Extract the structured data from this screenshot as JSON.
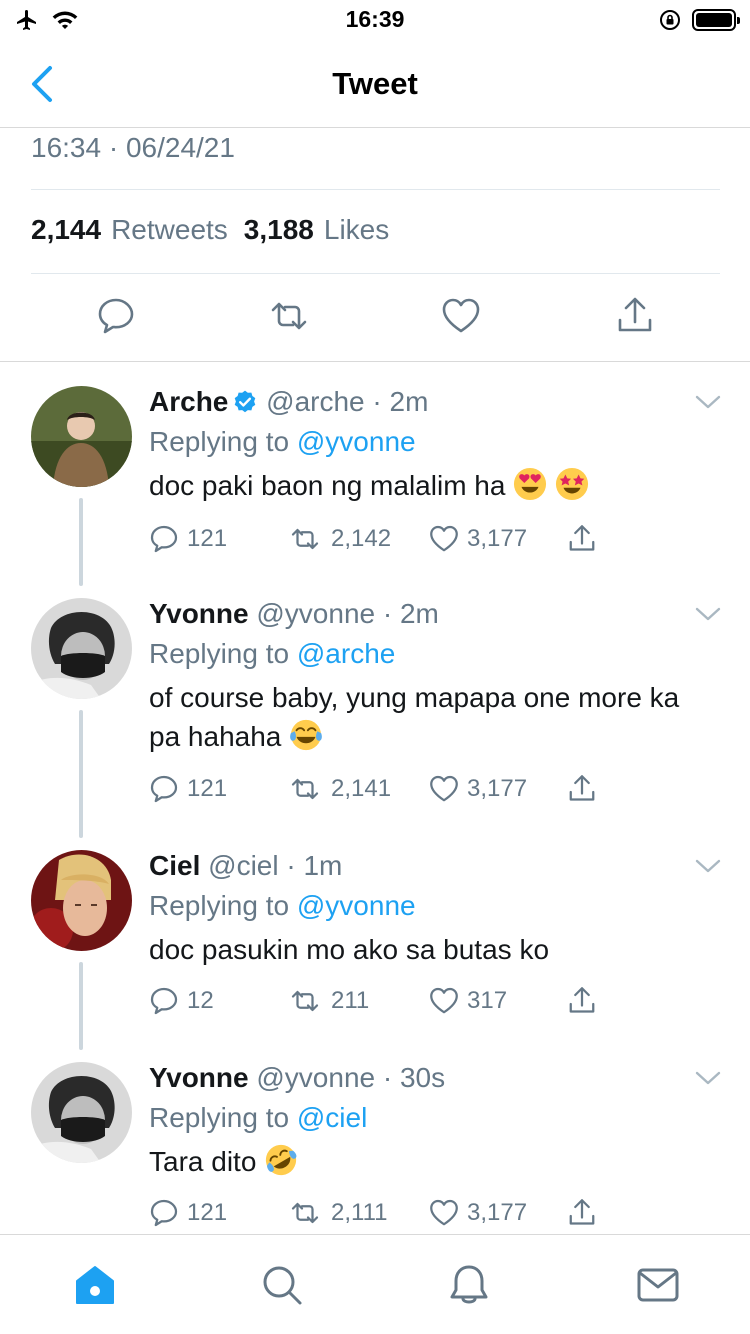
{
  "status_bar": {
    "time": "16:39",
    "icons": [
      "airplane-icon",
      "wifi-icon",
      "orientation-lock-icon",
      "battery-icon"
    ]
  },
  "nav": {
    "title": "Tweet",
    "back_icon": "chevron-left-icon"
  },
  "tweet": {
    "timestamp": "16:34 · 06/24/21",
    "retweets_count": "2,144",
    "retweets_label": "Retweets",
    "likes_count": "3,188",
    "likes_label": "Likes",
    "actions": [
      "reply-icon",
      "retweet-icon",
      "like-icon",
      "share-icon"
    ]
  },
  "replies": [
    {
      "name": "Arche",
      "verified": true,
      "handle": "@arche",
      "time": "· 2m",
      "replying_prefix": "Replying to",
      "replying_to": "@yvonne",
      "text": "doc paki baon ng malalim ha",
      "emojis": [
        "heart-eyes-emoji",
        "star-struck-emoji"
      ],
      "reply_count": "121",
      "retweet_count": "2,142",
      "like_count": "3,177"
    },
    {
      "name": "Yvonne",
      "verified": false,
      "handle": "@yvonne",
      "time": "· 2m",
      "replying_prefix": "Replying to",
      "replying_to": "@arche",
      "text": "of course baby, yung mapapa one more ka pa hahaha",
      "emojis": [
        "tears-of-joy-emoji"
      ],
      "reply_count": "121",
      "retweet_count": "2,141",
      "like_count": "3,177"
    },
    {
      "name": "Ciel",
      "verified": false,
      "handle": "@ciel",
      "time": "· 1m",
      "replying_prefix": "Replying to",
      "replying_to": "@yvonne",
      "text": "doc pasukin mo ako sa butas ko",
      "emojis": [],
      "reply_count": "12",
      "retweet_count": "211",
      "like_count": "317"
    },
    {
      "name": "Yvonne",
      "verified": false,
      "handle": "@yvonne",
      "time": "· 30s",
      "replying_prefix": "Replying to",
      "replying_to": "@ciel",
      "text": "Tara dito",
      "emojis": [
        "rofl-emoji"
      ],
      "reply_count": "121",
      "retweet_count": "2,111",
      "like_count": "3,177"
    }
  ],
  "tab_bar": {
    "tabs": [
      "home-icon",
      "search-icon",
      "notifications-icon",
      "messages-icon"
    ],
    "active": "home-icon"
  },
  "colors": {
    "accent": "#1da1f2",
    "muted": "#657786",
    "text": "#14171a",
    "divider": "#e1e8ed"
  }
}
